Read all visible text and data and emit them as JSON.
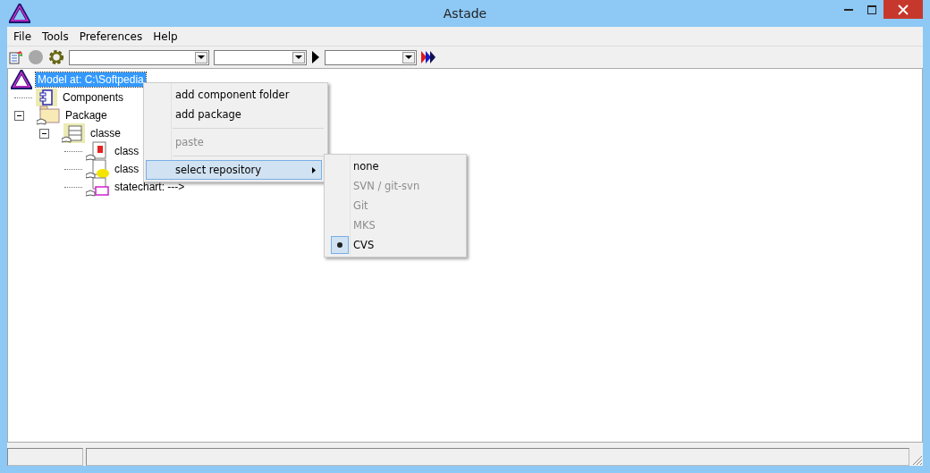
{
  "window": {
    "title": "Astade"
  },
  "menu_bar": [
    "File",
    "Tools",
    "Preferences",
    "Help"
  ],
  "tree": {
    "label": "Model at: C:\\Softpedia",
    "kind": "model",
    "selected": true,
    "children": [
      {
        "label": "Components",
        "kind": "component",
        "selected": false
      },
      {
        "label": "Package",
        "kind": "package",
        "selected": false,
        "expanded": true,
        "children": [
          {
            "label": "classe",
            "kind": "class",
            "selected": false,
            "expanded": true,
            "children": [
              {
                "label": "class",
                "kind": "stop-class",
                "selected": false
              },
              {
                "label": "class",
                "kind": "lib-class",
                "selected": false
              },
              {
                "label": "statechart:  --->",
                "kind": "statechart",
                "selected": false
              }
            ]
          }
        ]
      }
    ]
  },
  "context_menu": {
    "groups": [
      [
        {
          "label": "add component folder",
          "disabled": false,
          "highlighted": false,
          "submenu": false
        },
        {
          "label": "add package",
          "disabled": false,
          "highlighted": false,
          "submenu": false
        }
      ],
      [
        {
          "label": "paste",
          "disabled": true,
          "highlighted": false,
          "submenu": false
        }
      ],
      [
        {
          "label": "select repository",
          "disabled": false,
          "highlighted": true,
          "submenu": true
        }
      ]
    ]
  },
  "submenu": [
    {
      "label": "none",
      "disabled": false,
      "selected": false
    },
    {
      "label": "SVN / git-svn",
      "disabled": true,
      "selected": false
    },
    {
      "label": "Git",
      "disabled": true,
      "selected": false
    },
    {
      "label": "MKS",
      "disabled": true,
      "selected": false
    },
    {
      "label": "CVS",
      "disabled": false,
      "selected": true
    }
  ]
}
